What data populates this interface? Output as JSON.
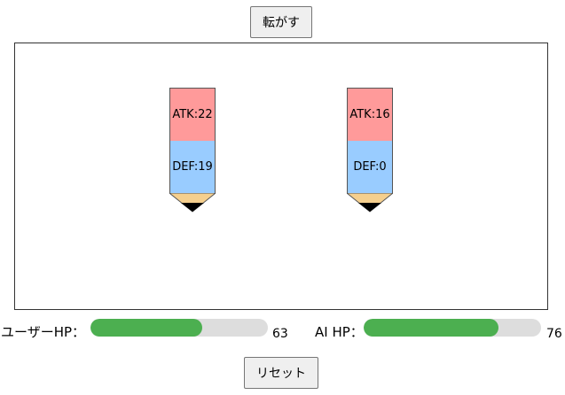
{
  "controls": {
    "roll_label": "転がす",
    "reset_label": "リセット"
  },
  "pencils": {
    "user": {
      "atk": "ATK:22",
      "def": "DEF:19"
    },
    "ai": {
      "atk": "ATK:16",
      "def": "DEF:0"
    }
  },
  "hp": {
    "user": {
      "label": "ユーザーHP：",
      "value": 63,
      "value_text": "63",
      "max": 100,
      "fraction": 0.63
    },
    "ai": {
      "label": "AI HP：",
      "value": 76,
      "value_text": "76",
      "max": 100,
      "fraction": 0.76
    }
  },
  "colors": {
    "atk": "#ff9a9a",
    "def": "#99ccff",
    "hp_fill": "#4caf50",
    "hp_track": "#dddddd",
    "pencil_wood": "#f5cf8e",
    "pencil_lead": "#000000"
  }
}
